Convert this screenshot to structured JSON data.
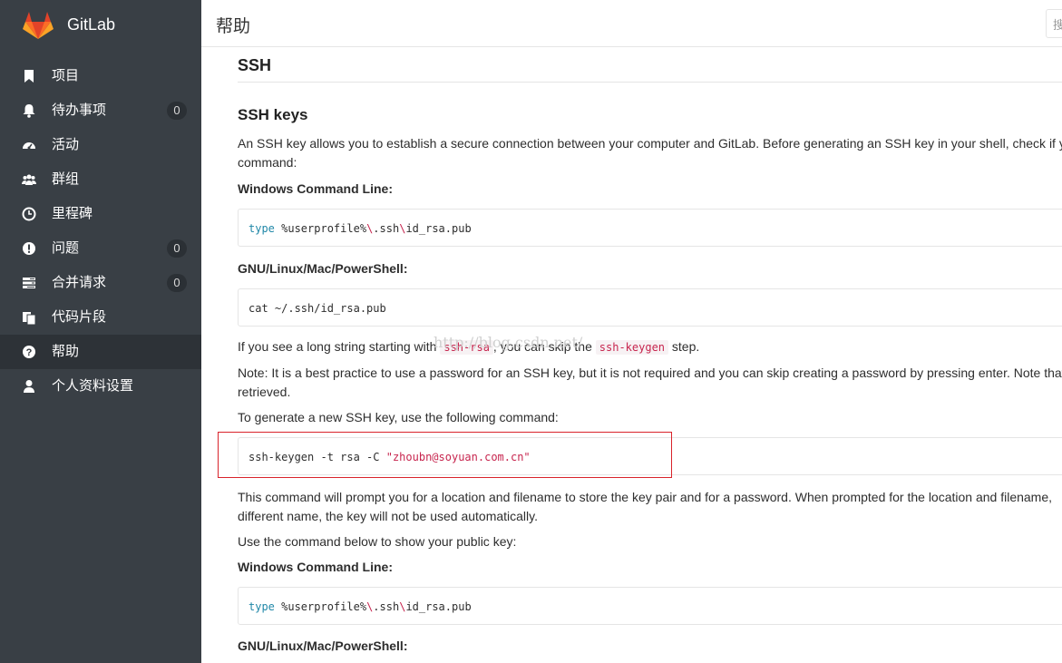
{
  "app": {
    "name": "GitLab",
    "page_title": "帮助",
    "search_placeholder": "搜"
  },
  "sidebar": {
    "items": [
      {
        "label": "项目",
        "icon": "bookmark-icon",
        "badge": null
      },
      {
        "label": "待办事项",
        "icon": "bell-icon",
        "badge": "0"
      },
      {
        "label": "活动",
        "icon": "dashboard-icon",
        "badge": null
      },
      {
        "label": "群组",
        "icon": "users-icon",
        "badge": null
      },
      {
        "label": "里程碑",
        "icon": "clock-icon",
        "badge": null
      },
      {
        "label": "问题",
        "icon": "exclamation-icon",
        "badge": "0"
      },
      {
        "label": "合并请求",
        "icon": "tasks-icon",
        "badge": "0"
      },
      {
        "label": "代码片段",
        "icon": "clipboard-icon",
        "badge": null
      },
      {
        "label": "帮助",
        "icon": "question-icon",
        "badge": null,
        "active": true
      },
      {
        "label": "个人资料设置",
        "icon": "user-icon",
        "badge": null
      }
    ]
  },
  "doc": {
    "h_ssh": "SSH",
    "h_keys": "SSH keys",
    "intro_1": "An SSH key allows you to establish a secure connection between your computer and GitLab. Before generating an SSH key in your shell, check if yo",
    "intro_2": "command:",
    "win_label": "Windows Command Line:",
    "win_cmd": {
      "kw": "type",
      "a": " %userprofile%",
      "s1": "\\",
      "b": ".ssh",
      "s2": "\\",
      "c": "id_rsa.pub"
    },
    "unix_label": "GNU/Linux/Mac/PowerShell:",
    "unix_cmd": "cat ~/.ssh/id_rsa.pub",
    "skip_a": "If you see a long string starting with ",
    "skip_code1": "ssh-rsa",
    "skip_b": ", you can skip the ",
    "skip_code2": "ssh-keygen",
    "skip_c": " step.",
    "note_1": "Note: It is a best practice to use a password for an SSH key, but it is not required and you can skip creating a password by pressing enter. Note that t",
    "note_2": "retrieved.",
    "gen_intro": "To generate a new SSH key, use the following command:",
    "gen_cmd": {
      "a": "ssh-keygen -t rsa -C ",
      "s": "\"zhoubn@soyuan.com.cn\""
    },
    "prompt_1": "This command will prompt you for a location and filename to store the key pair and for a password. When prompted for the location and filename,",
    "prompt_2": "different name, the key will not be used automatically.",
    "show_intro": "Use the command below to show your public key:",
    "win_label2": "Windows Command Line:",
    "unix_label2": "GNU/Linux/Mac/PowerShell:"
  },
  "watermark": "http://blog.csdn.net/",
  "colors": {
    "sidebar_bg": "#393f45",
    "active_bg": "#2d3237",
    "highlight_border": "#d9232b",
    "code_keyword": "#2188a8",
    "code_string": "#c7254e"
  }
}
